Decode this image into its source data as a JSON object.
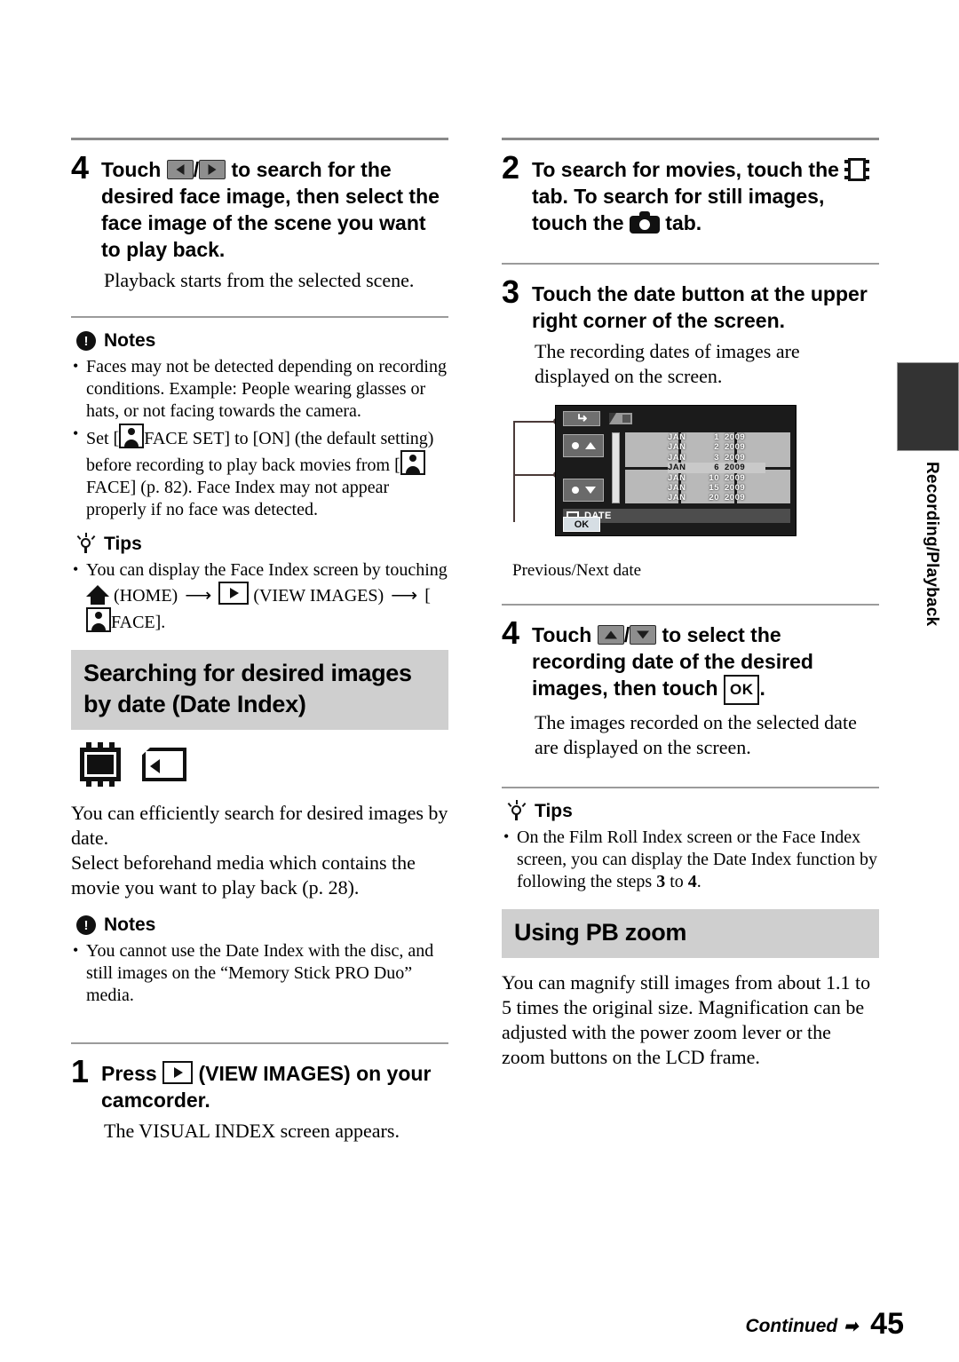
{
  "page": {
    "number": "45",
    "continued_label": "Continued",
    "continued_arrow": "➡"
  },
  "side_tab": {
    "label": "Recording/Playback"
  },
  "left_column": {
    "step4": {
      "number": "4",
      "text_a": "Touch",
      "text_b": "to search for the desired face image, then select the face image of the scene you want to play back.",
      "description": "Playback starts from the selected scene."
    },
    "notes1": {
      "heading": "Notes",
      "items": [
        "Faces may not be detected depending on recording conditions. Example: People wearing glasses or hats, or not facing towards the camera.",
        "Set [ FACE SET] to [ON] (the default setting) before recording to play back movies from [ FACE] (p. 82). Face Index may not appear properly if no face was detected."
      ],
      "item2_parts": {
        "p1": "Set [",
        "p2": "FACE SET] to [ON] (the default setting) before recording to play back movies from [",
        "p3": "FACE] (p. 82). Face Index may not appear properly if no face was detected."
      }
    },
    "tips1": {
      "heading": "Tips",
      "item_parts": {
        "p1": "You can display the Face Index screen by touching",
        "p2": "(HOME)",
        "p3": "(VIEW IMAGES)",
        "p4": "[",
        "p5": "FACE]."
      }
    },
    "section_heading": "Searching for desired images by date (Date Index)",
    "intro_para1": "You can efficiently search for desired images by date.",
    "intro_para2": "Select beforehand media which contains the movie you want to play back (p. 28).",
    "notes2": {
      "heading": "Notes",
      "items": [
        "You cannot use the Date Index with the disc, and still images on the “Memory Stick PRO Duo” media."
      ]
    },
    "step1": {
      "number": "1",
      "text_a": "Press",
      "text_b": "(VIEW IMAGES) on your camcorder.",
      "description": "The VISUAL INDEX screen appears."
    }
  },
  "right_column": {
    "step2": {
      "number": "2",
      "text_a": "To search for movies, touch the",
      "text_b": "tab. To search for still images, touch the",
      "text_c": "tab."
    },
    "step3": {
      "number": "3",
      "text": "Touch the date button at the upper right corner of the screen.",
      "description": "The recording dates of images are displayed on the screen."
    },
    "lcd": {
      "date_label": "DATE",
      "ok_label": "OK",
      "dates": [
        {
          "month": "JAN",
          "day": "1",
          "year": "2009",
          "selected": false
        },
        {
          "month": "JAN",
          "day": "2",
          "year": "2009",
          "selected": false
        },
        {
          "month": "JAN",
          "day": "3",
          "year": "2009",
          "selected": false
        },
        {
          "month": "JAN",
          "day": "6",
          "year": "2009",
          "selected": true
        },
        {
          "month": "JAN",
          "day": "10",
          "year": "2009",
          "selected": false
        },
        {
          "month": "JAN",
          "day": "15",
          "year": "2009",
          "selected": false
        },
        {
          "month": "JAN",
          "day": "20",
          "year": "2009",
          "selected": false
        }
      ],
      "caption": "Previous/Next date"
    },
    "step4": {
      "number": "4",
      "text_a": "Touch",
      "text_b": "to select the recording date of the desired images, then touch",
      "ok_label": "OK",
      "text_c": ".",
      "description": "The images recorded on the selected date are displayed on the screen."
    },
    "tips2": {
      "heading": "Tips",
      "item_parts": {
        "p1": "On the Film Roll Index screen or the Face Index screen, you can display the Date Index function by following the steps",
        "step_a": "3",
        "mid": "to",
        "step_b": "4",
        "p2": "."
      }
    },
    "section_heading": "Using PB zoom",
    "para": "You can magnify still images from about 1.1 to 5 times the original size. Magnification can be adjusted with the power zoom lever or the zoom buttons on the LCD frame."
  }
}
